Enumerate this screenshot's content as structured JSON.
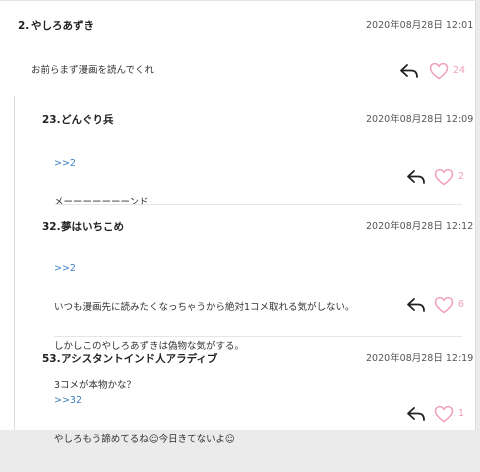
{
  "comments": [
    {
      "num": "2.",
      "name": "やしろあずき",
      "date": "2020年08月28日 12:01",
      "reply_to": "",
      "lines": [
        "お前らまず漫画を読んでくれ"
      ],
      "likes": "24"
    },
    {
      "num": "23.",
      "name": "どんぐり兵",
      "date": "2020年08月28日 12:09",
      "reply_to": ">>2",
      "lines": [
        "メーーーーーーーンド"
      ],
      "likes": "2"
    },
    {
      "num": "32.",
      "name": "夢はいちこめ",
      "date": "2020年08月28日 12:12",
      "reply_to": ">>2",
      "lines": [
        "いつも漫画先に読みたくなっちゃうから絶対1コメ取れる気がしない。",
        "しかしこのやしろあずきは偽物な気がする。",
        "3コメが本物かな？"
      ],
      "likes": "6"
    },
    {
      "num": "53.",
      "name": "アシスタントインド人アラディブ",
      "date": "2020年08月28日 12:19",
      "reply_to": ">>32",
      "lines": [
        "やしろもう諦めてるね☺今日きてないよ☺"
      ],
      "likes": "1"
    }
  ],
  "icons": {
    "reply": "reply-arrow-icon",
    "like": "heart-outline-icon"
  },
  "colors": {
    "link": "#3d7fc1",
    "heart": "#f0a0b8",
    "background": "#ebebeb"
  }
}
